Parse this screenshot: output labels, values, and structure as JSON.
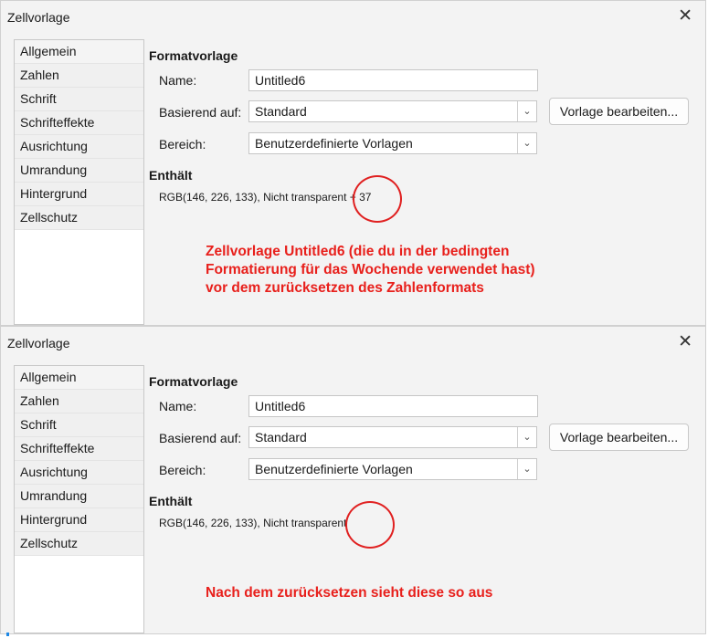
{
  "top_dialog": {
    "title": "Zellvorlage",
    "close_glyph": "✕",
    "sidebar": [
      "Allgemein",
      "Zahlen",
      "Schrift",
      "Schrifteffekte",
      "Ausrichtung",
      "Umrandung",
      "Hintergrund",
      "Zellschutz"
    ],
    "section_title": "Formatvorlage",
    "name_label": "Name:",
    "name_value": "Untitled6",
    "based_label": "Basierend auf:",
    "based_value": "Standard",
    "edit_button": "Vorlage bearbeiten...",
    "category_label": "Bereich:",
    "category_value": "Benutzerdefinierte Vorlagen",
    "contains_title": "Enthält",
    "contains_value": "RGB(146, 226, 133), Nicht transparent + 37",
    "annotation": [
      "Zellvorlage Untitled6 (die du in der bedingten",
      "Formatierung für das Wochende verwendet hast)",
      "vor dem zurücksetzen des Zahlenformats"
    ]
  },
  "bottom_dialog": {
    "title": "Zellvorlage",
    "close_glyph": "✕",
    "sidebar": [
      "Allgemein",
      "Zahlen",
      "Schrift",
      "Schrifteffekte",
      "Ausrichtung",
      "Umrandung",
      "Hintergrund",
      "Zellschutz"
    ],
    "section_title": "Formatvorlage",
    "name_label": "Name:",
    "name_value": "Untitled6",
    "based_label": "Basierend auf:",
    "based_value": "Standard",
    "edit_button": "Vorlage bearbeiten...",
    "category_label": "Bereich:",
    "category_value": "Benutzerdefinierte Vorlagen",
    "contains_title": "Enthält",
    "contains_value": "RGB(146, 226, 133), Nicht transparent",
    "annotation": "Nach dem zurücksetzen sieht diese so aus"
  },
  "colors": {
    "annotation": "#e8201c",
    "circle": "#e02020"
  },
  "icons": {
    "close": "close-icon",
    "dropdown": "chevron-down-icon"
  }
}
